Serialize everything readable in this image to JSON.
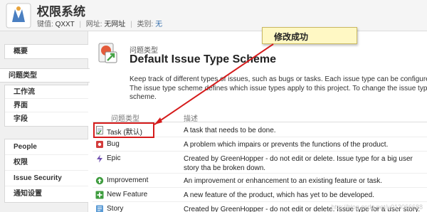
{
  "header": {
    "title": "权限系统",
    "key_label": "键值:",
    "key_value": "QXXT",
    "url_label": "网址:",
    "url_value": "无网址",
    "category_label": "类别:",
    "category_value": "无"
  },
  "sidebar": {
    "summary": "概要",
    "active": "问题类型",
    "group1": [
      "工作流",
      "界面",
      "字段"
    ],
    "group2": [
      "People",
      "权限",
      "Issue Security",
      "通知设置"
    ]
  },
  "main": {
    "pre_title": "问题类型",
    "title": "Default Issue Type Scheme",
    "desc_lines": [
      "Keep track of different types of issues, such as bugs or tasks. Each issue type can be configured diff",
      "The issue type scheme defines which issue types apply to this project. To change the issue types u",
      "scheme."
    ],
    "col_type": "问题类型",
    "col_desc": "描述",
    "rows": [
      {
        "name": "Task (默认)",
        "desc": "A task that needs to be done.",
        "icon": "task-icon"
      },
      {
        "name": "Bug",
        "desc": "A problem which impairs or prevents the functions of the product.",
        "icon": "bug-icon"
      },
      {
        "name": "Epic",
        "desc": "Created by GreenHopper - do not edit or delete. Issue type for a big user story tha be broken down.",
        "icon": "epic-icon"
      },
      {
        "name": "Improvement",
        "desc": "An improvement or enhancement to an existing feature or task.",
        "icon": "improvement-icon"
      },
      {
        "name": "New Feature",
        "desc": "A new feature of the product, which has yet to be developed.",
        "icon": "new-feature-icon"
      },
      {
        "name": "Story",
        "desc": "Created by GreenHopper - do not edit or delete. Issue type for a user story.",
        "icon": "story-icon"
      }
    ]
  },
  "callout": {
    "text": "修改成功"
  },
  "watermark": "http://blog.csdn.net/u013066688",
  "colors": {
    "highlight": "#d51b1b",
    "callout_bg": "#fff8c4",
    "link": "#3b73af"
  }
}
